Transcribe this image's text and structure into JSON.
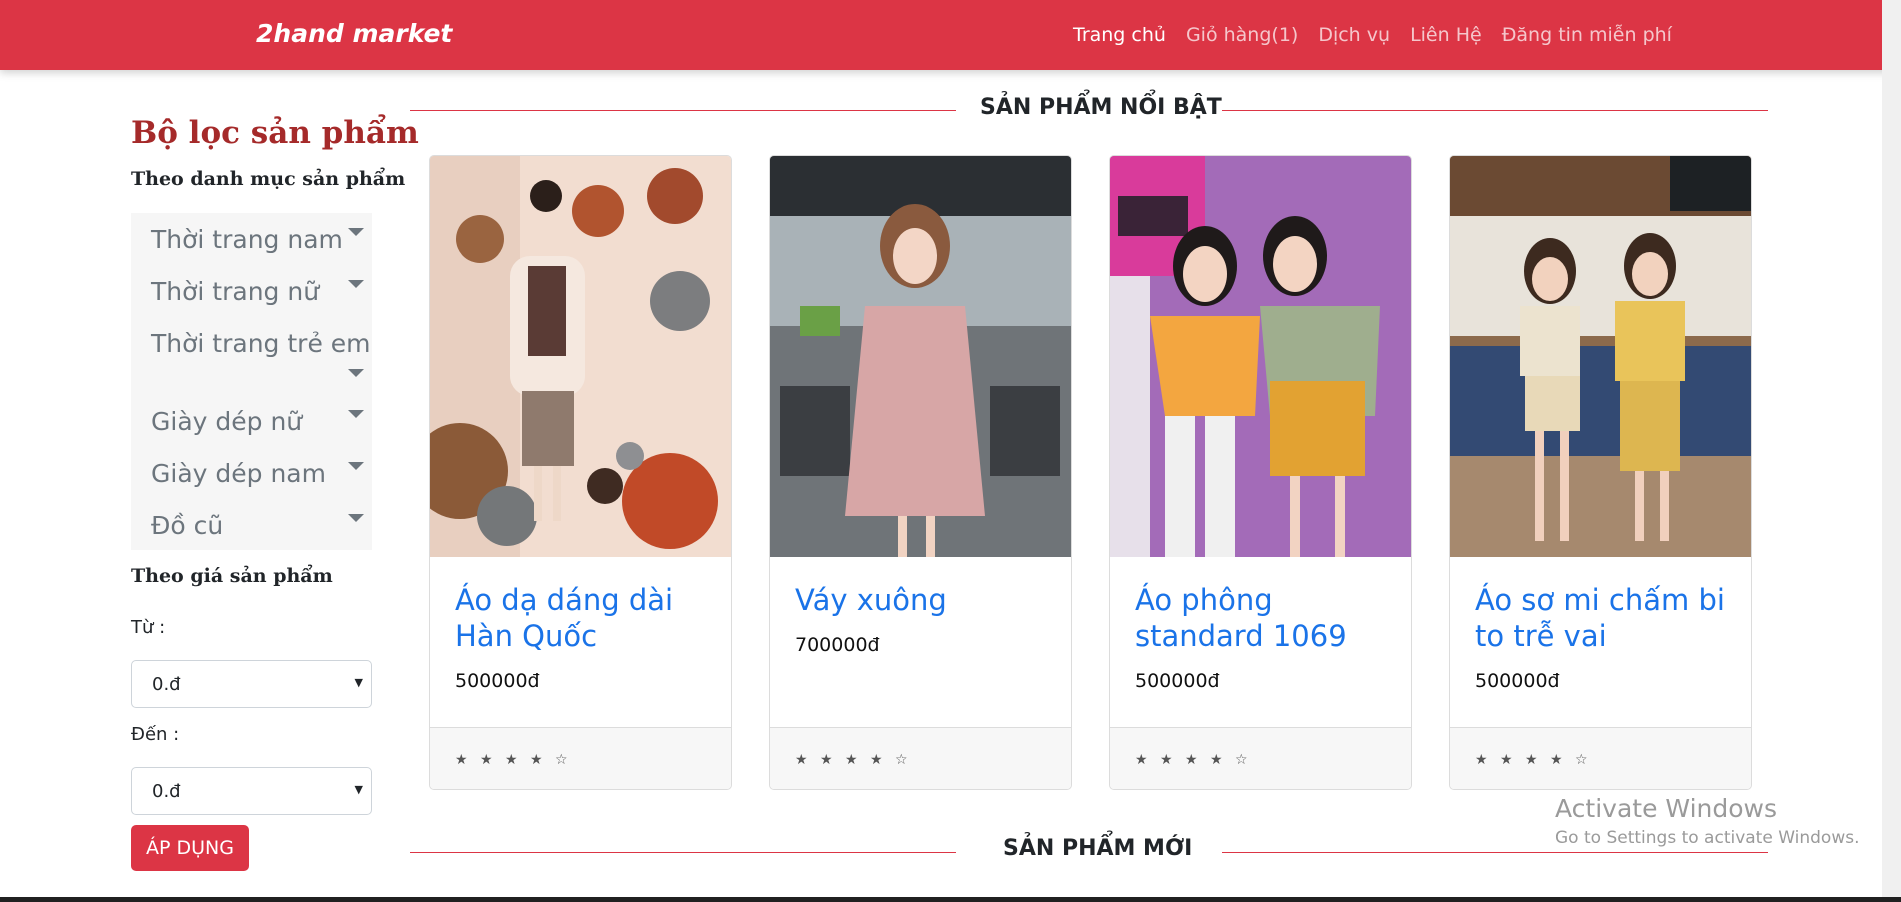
{
  "navbar": {
    "brand": "2hand market",
    "links": [
      "Trang chủ",
      "Giỏ hàng(1)",
      "Dịch vụ",
      "Liên Hệ",
      "Đăng tin miễn phí"
    ]
  },
  "sidebar": {
    "title": "Bộ lọc sản phẩm",
    "category_heading": "Theo danh mục sản phẩm",
    "categories": [
      "Thời trang nam",
      "Thời trang nữ",
      "Thời trang trẻ em",
      "Giày dép nữ",
      "Giày dép nam",
      "Đồ cũ"
    ],
    "price_heading": "Theo giá sản phẩm",
    "from_label": "Từ :",
    "from_value": "0.đ",
    "to_label": "Đến :",
    "to_value": "0.đ",
    "apply_label": "ÁP DỤNG"
  },
  "sections": {
    "featured": "SẢN PHẨM NỔI BẬT",
    "new": "SẢN PHẨM MỚI"
  },
  "products": [
    {
      "name": "Áo dạ dáng dài Hàn Quốc",
      "price": "500000đ",
      "rating": "★ ★ ★ ★ ☆"
    },
    {
      "name": "Váy xuông",
      "price": "700000đ",
      "rating": "★ ★ ★ ★ ☆"
    },
    {
      "name": "Áo phông standard 1069",
      "price": "500000đ",
      "rating": "★ ★ ★ ★ ☆"
    },
    {
      "name": "Áo sơ mi chấm bi to trễ vai",
      "price": "500000đ",
      "rating": "★ ★ ★ ★ ☆"
    }
  ],
  "windows": {
    "title": "Activate Windows",
    "subtitle": "Go to Settings to activate Windows."
  },
  "colors": {
    "accent": "#dc3545",
    "link": "#1a73e8",
    "title_brown": "#a52a2a"
  }
}
